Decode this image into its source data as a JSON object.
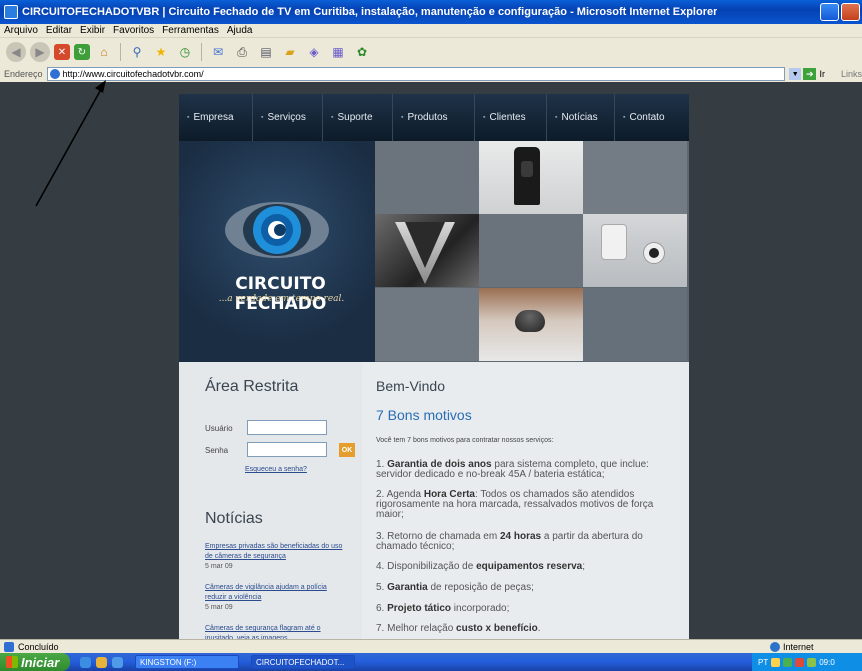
{
  "window": {
    "title": "CIRCUITOFECHADOTVBR | Circuito Fechado de TV em Curitiba, instalação, manutenção e configuração - Microsoft Internet Explorer"
  },
  "menu": [
    "Arquivo",
    "Editar",
    "Exibir",
    "Favoritos",
    "Ferramentas",
    "Ajuda"
  ],
  "address": {
    "label": "Endereço",
    "url": "http://www.circuitofechadotvbr.com/",
    "go": "Ir",
    "links": "Links"
  },
  "site": {
    "nav": [
      "Empresa",
      "Serviços",
      "Suporte",
      "Produtos",
      "Clientes",
      "Notícias",
      "Contato"
    ],
    "brand": "CIRCUITO FECHADO",
    "tagline": "...a verdade em tempo real.",
    "restricted": {
      "title": "Área Restrita",
      "user_label": "Usuário",
      "pass_label": "Senha",
      "ok": "OK",
      "forgot": "Esqueceu a senha?"
    },
    "news": {
      "title": "Notícias",
      "items": [
        {
          "title": "Empresas privadas são beneficiadas do uso de câmeras de segurança",
          "date": "5 mar 09"
        },
        {
          "title": "Câmeras de vigilância ajudam a polícia reduzir a violência",
          "date": "5 mar 09"
        },
        {
          "title": "Câmeras de segurança flagram até o inusitado, veja as imagens...",
          "date": ""
        }
      ]
    },
    "welcome": {
      "title": "Bem-Vindo",
      "subtitle": "7 Bons motivos",
      "intro": "Você tem 7 bons motivos para contratar nossos serviços:",
      "items": [
        {
          "num": "1.",
          "strong": "Garantia de dois anos",
          "text": " para sistema completo, que inclue: servidor dedicado e no-break 45A / bateria estática;"
        },
        {
          "num": "2.",
          "pre": "Agenda ",
          "strong": "Hora Certa",
          "text": ": Todos os chamados são atendidos rigorosamente na hora marcada, ressalvados motivos de força maior;"
        },
        {
          "num": "3.",
          "pre": "Retorno de chamada em ",
          "strong": "24 horas",
          "text": " a partir da abertura do chamado técnico;"
        },
        {
          "num": "4.",
          "pre": "Disponibilização de ",
          "strong": "equipamentos reserva",
          "text": ";"
        },
        {
          "num": "5.",
          "strong": "Garantia",
          "text": " de reposição de peças;"
        },
        {
          "num": "6.",
          "strong": "Projeto tático",
          "text": " incorporado;"
        },
        {
          "num": "7.",
          "pre": "Melhor relação ",
          "strong": "custo x benefício",
          "text": "."
        }
      ]
    }
  },
  "status": {
    "text": "Concluído",
    "zone": "Internet"
  },
  "taskbar": {
    "start": "Iniciar",
    "tasks": [
      "KINGSTON (F:)",
      "CIRCUITOFECHADOT..."
    ],
    "tray": "PT",
    "clock": "09:0"
  },
  "icons": {
    "back": "back-arrow-icon",
    "forward": "forward-arrow-icon",
    "stop": "stop-icon",
    "refresh": "refresh-icon",
    "home": "home-icon",
    "search": "search-icon",
    "favorites": "star-icon",
    "history": "history-icon",
    "mail": "mail-icon",
    "print": "printer-icon",
    "edit": "edit-icon",
    "folder": "folder-icon",
    "messenger": "messenger-icon"
  },
  "colors": {
    "nav_bg": "#0d1b29",
    "accent_blue": "#2a6db5",
    "ok_orange": "#e59e2c",
    "page_bg": "#363d42"
  }
}
